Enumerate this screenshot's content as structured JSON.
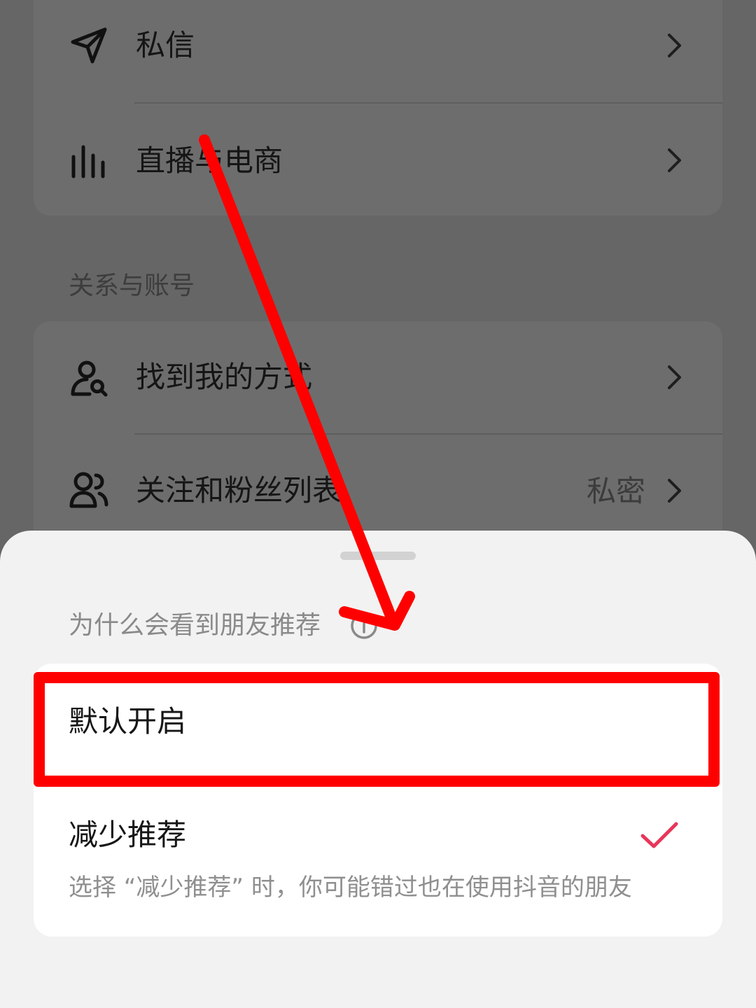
{
  "background_page": {
    "rows": [
      {
        "label": "私信",
        "icon": "send-icon"
      },
      {
        "label": "直播与电商",
        "icon": "live-bars-icon"
      }
    ],
    "section_title": "关系与账号",
    "relation_rows": [
      {
        "label": "找到我的方式",
        "icon": "person-search-icon",
        "value": ""
      },
      {
        "label": "关注和粉丝列表",
        "icon": "people-icon",
        "value": "私密"
      }
    ]
  },
  "sheet": {
    "title": "为什么会看到朋友推荐",
    "options": [
      {
        "label": "默认开启",
        "description": "",
        "selected": false
      },
      {
        "label": "减少推荐",
        "description": "选择 “减少推荐” 时，你可能错过也在使用抖音的朋友",
        "selected": true
      }
    ]
  },
  "colors": {
    "accent_check": "#e8365a",
    "annotation_red": "#ff0000",
    "overlay_dim": "#666666"
  }
}
